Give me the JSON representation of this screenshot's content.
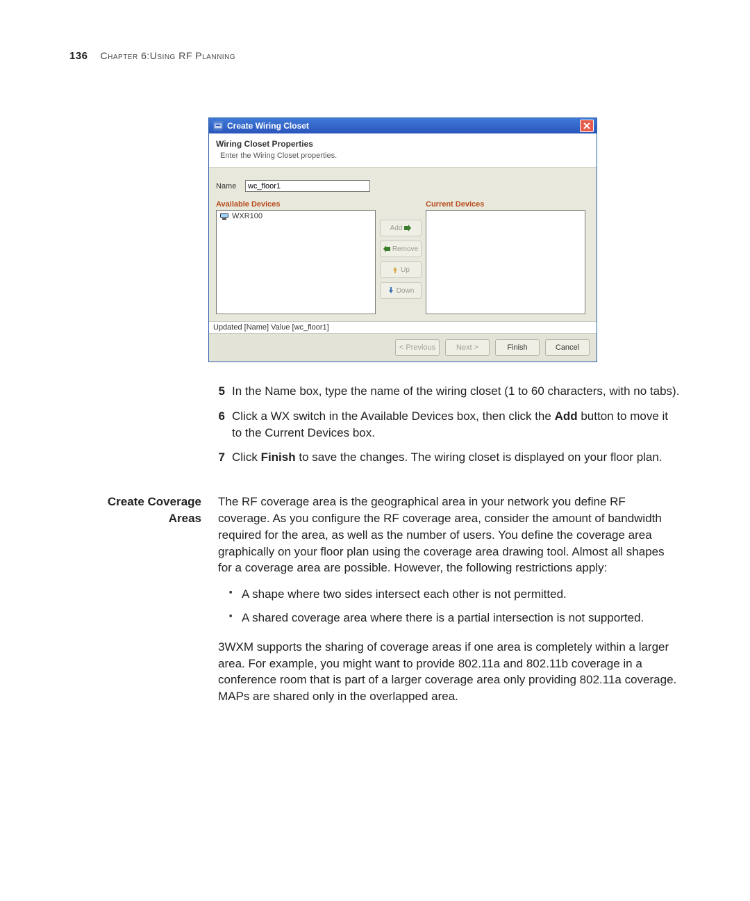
{
  "header": {
    "page_number": "136",
    "chapter_line_prefix": "Chapter 6: ",
    "chapter_line_rest": "Using RF Planning"
  },
  "dialog": {
    "title": "Create Wiring Closet",
    "heading": "Wiring Closet Properties",
    "subheading": "Enter the Wiring Closet properties.",
    "name_label": "Name",
    "name_value": "wc_floor1",
    "available_label": "Available Devices",
    "current_label": "Current Devices",
    "available_items": [
      "WXR100"
    ],
    "buttons": {
      "add": "Add",
      "remove": "Remove",
      "up": "Up",
      "down": "Down"
    },
    "status": "Updated [Name] Value [wc_floor1]",
    "footer": {
      "previous": "< Previous",
      "next": "Next >",
      "finish": "Finish",
      "cancel": "Cancel"
    }
  },
  "steps": {
    "s5": {
      "num": "5",
      "text": "In the Name box, type the name of the wiring closet (1 to 60 characters, with no tabs)."
    },
    "s6": {
      "num": "6",
      "text_a": "Click a WX switch in the Available Devices box, then click the ",
      "bold_a": "Add",
      "text_b": " button to move it to the Current Devices box."
    },
    "s7": {
      "num": "7",
      "text_a": "Click ",
      "bold_a": "Finish",
      "text_b": " to save the changes. The wiring closet is displayed on your floor plan."
    }
  },
  "section": {
    "label_a": "Create Coverage",
    "label_b": "Areas",
    "para1": "The RF coverage area is the geographical area in your network you define RF coverage. As you configure the RF coverage area, consider the amount of bandwidth required for the area, as well as the number of users. You define the coverage area graphically on your floor plan using the coverage area drawing tool. Almost all shapes for a coverage area are possible. However, the following restrictions apply:",
    "bullets": [
      "A shape where two sides intersect each other is not permitted.",
      "A shared coverage area where there is a partial intersection is not supported."
    ],
    "para2": "3WXM supports the sharing of coverage areas if one area is completely within a larger area. For example, you might want to provide 802.11a and 802.11b coverage in a conference room that is part of a larger coverage area only providing 802.11a coverage. MAPs are shared only in the overlapped area."
  }
}
